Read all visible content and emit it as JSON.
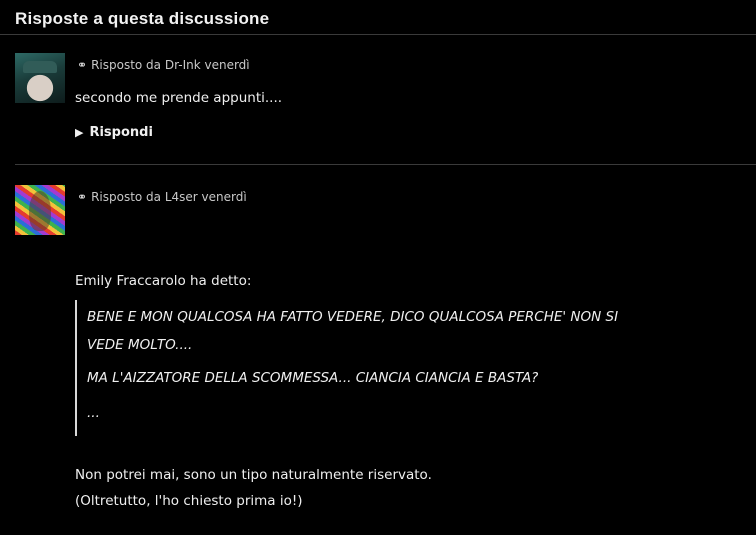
{
  "section": {
    "title": "Risposte a questa discussione"
  },
  "icons": {
    "link": "link-icon",
    "reply_arrow": "play-arrow-icon"
  },
  "posts": [
    {
      "meta": "Risposto da Dr-Ink venerdì",
      "text": "secondo me prende appunti....",
      "reply_label": "Rispondi"
    },
    {
      "meta": "Risposto da L4ser venerdì",
      "quote_attribution": "Emily Fraccarolo ha detto:",
      "quote_lines": [
        "BENE E MON QUALCOSA HA FATTO VEDERE, DICO QUALCOSA PERCHE' NON SI",
        "VEDE MOLTO....",
        "MA L'AIZZATORE DELLA SCOMMESSA... CIANCIA CIANCIA E BASTA?",
        "..."
      ],
      "reply_lines": [
        "Non potrei mai, sono un tipo naturalmente riservato.",
        "(Oltretutto, l'ho chiesto prima io!)"
      ]
    }
  ]
}
